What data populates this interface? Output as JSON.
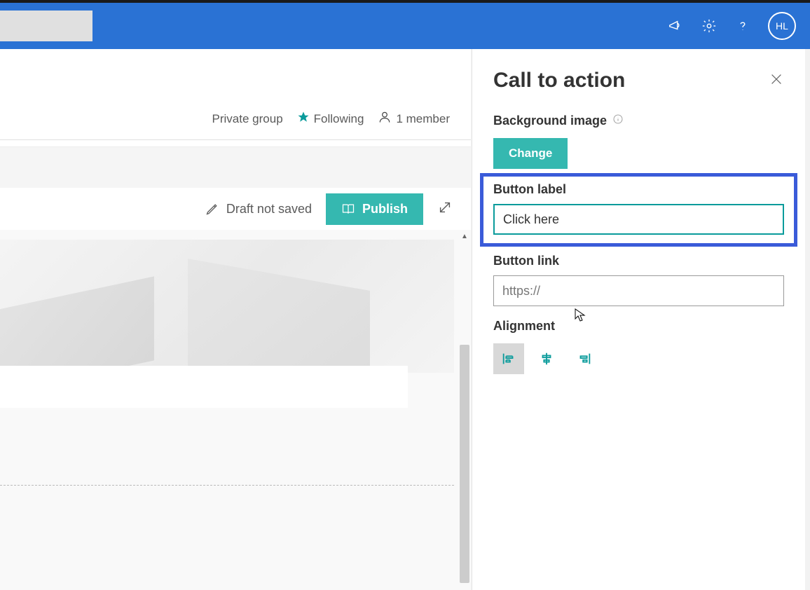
{
  "header": {
    "user_initials": "HL"
  },
  "site": {
    "group_type": "Private group",
    "follow_label": "Following",
    "members_label": "1 member"
  },
  "command": {
    "draft_label": "Draft not saved",
    "publish_label": "Publish"
  },
  "panel": {
    "title": "Call to action",
    "bg_label": "Background image",
    "change_label": "Change",
    "button_label_heading": "Button label",
    "button_label_value": "Click here",
    "button_link_heading": "Button link",
    "button_link_placeholder": "https://",
    "alignment_label": "Alignment"
  }
}
